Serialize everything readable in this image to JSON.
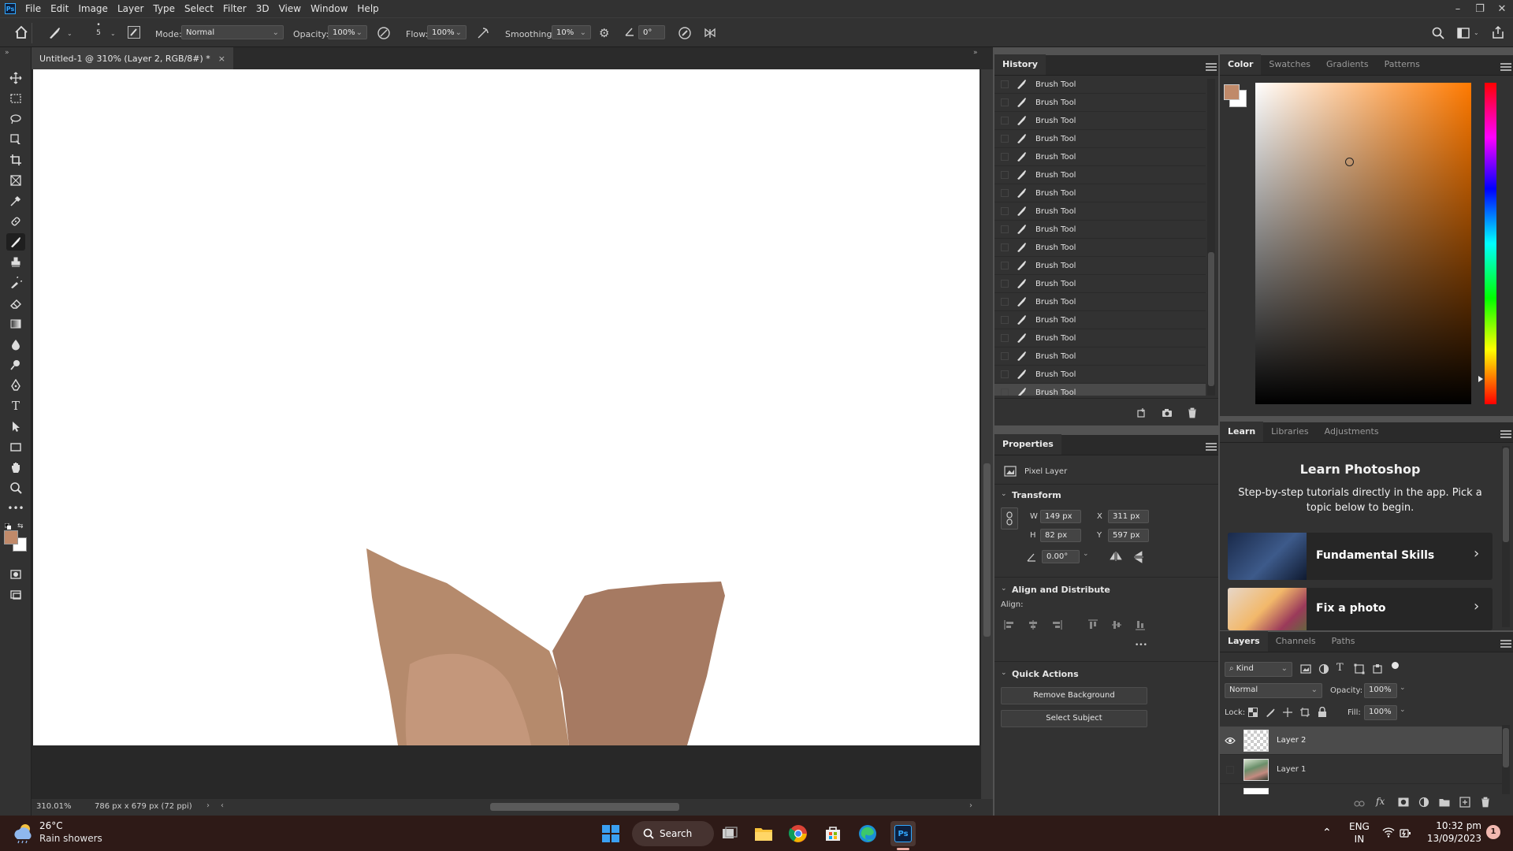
{
  "app": {
    "logo": "Ps"
  },
  "menu": [
    "File",
    "Edit",
    "Image",
    "Layer",
    "Type",
    "Select",
    "Filter",
    "3D",
    "View",
    "Window",
    "Help"
  ],
  "options": {
    "brush_size": "5",
    "mode_label": "Mode:",
    "mode_value": "Normal",
    "opacity_label": "Opacity:",
    "opacity_value": "100%",
    "flow_label": "Flow:",
    "flow_value": "100%",
    "smoothing_label": "Smoothing:",
    "smoothing_value": "10%",
    "angle_value": "0°"
  },
  "document": {
    "tab_title": "Untitled-1 @ 310% (Layer 2, RGB/8#) *",
    "zoom": "310.01%",
    "doc_info": "786 px x 679 px (72 ppi)"
  },
  "history": {
    "tab": "History",
    "items": [
      "Brush Tool",
      "Brush Tool",
      "Brush Tool",
      "Brush Tool",
      "Brush Tool",
      "Brush Tool",
      "Brush Tool",
      "Brush Tool",
      "Brush Tool",
      "Brush Tool",
      "Brush Tool",
      "Brush Tool",
      "Brush Tool",
      "Brush Tool",
      "Brush Tool",
      "Brush Tool",
      "Brush Tool",
      "Brush Tool"
    ]
  },
  "properties": {
    "tab": "Properties",
    "layer_type": "Pixel Layer",
    "transform_title": "Transform",
    "w_label": "W",
    "w_value": "149 px",
    "h_label": "H",
    "h_value": "82 px",
    "x_label": "X",
    "x_value": "311 px",
    "y_label": "Y",
    "y_value": "597 px",
    "angle_value": "0.00°",
    "align_title": "Align and Distribute",
    "align_label": "Align:",
    "more": "•••",
    "quick_actions_title": "Quick Actions",
    "remove_bg": "Remove Background",
    "select_subject": "Select Subject"
  },
  "color_panel": {
    "tabs": [
      "Color",
      "Swatches",
      "Gradients",
      "Patterns"
    ],
    "foreground": "#c08a6a",
    "background": "#ffffff",
    "hue_color": "#ff7a00"
  },
  "learn_panel": {
    "tabs": [
      "Learn",
      "Libraries",
      "Adjustments"
    ],
    "title": "Learn Photoshop",
    "subtitle": "Step-by-step tutorials directly in the app. Pick a topic below to begin.",
    "cards": [
      "Fundamental Skills",
      "Fix a photo"
    ]
  },
  "layers_panel": {
    "tabs": [
      "Layers",
      "Channels",
      "Paths"
    ],
    "filter_kind": "Kind",
    "blend_mode": "Normal",
    "opacity_label": "Opacity:",
    "opacity_value": "100%",
    "lock_label": "Lock:",
    "fill_label": "Fill:",
    "fill_value": "100%",
    "layers": [
      "Layer 2",
      "Layer 1"
    ]
  },
  "taskbar": {
    "temperature": "26°C",
    "weather": "Rain showers",
    "search": "Search",
    "lang_line1": "ENG",
    "lang_line2": "IN",
    "time": "10:32 pm",
    "date": "13/09/2023",
    "notif_count": "1"
  },
  "colors": {
    "skin_light": "#b58a6c",
    "skin_mid": "#c4977b",
    "skin_dark": "#a67a62"
  }
}
